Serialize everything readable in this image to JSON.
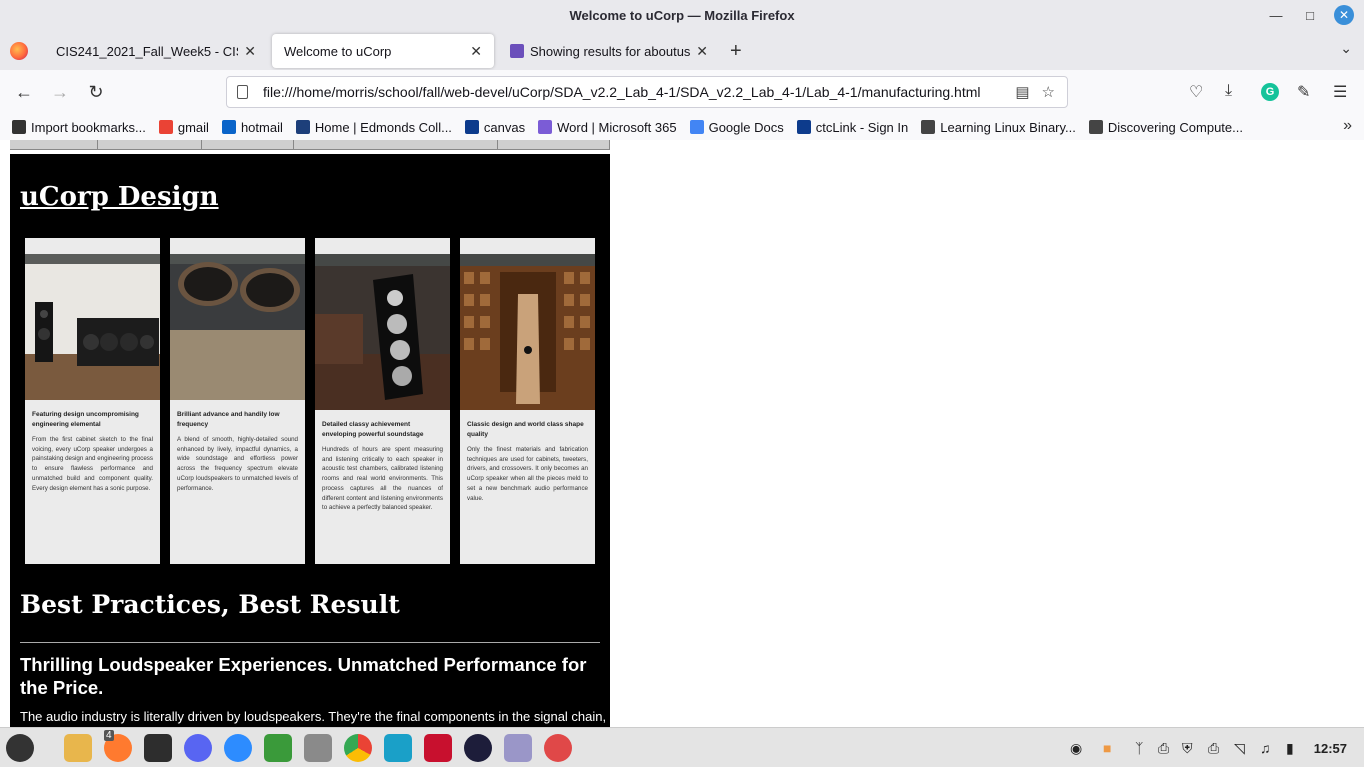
{
  "window": {
    "title": "Welcome to uCorp — Mozilla Firefox"
  },
  "tabs": [
    {
      "label": "CIS241_2021_Fall_Week5 - CIS2",
      "active": false
    },
    {
      "label": "Welcome to uCorp",
      "active": true
    },
    {
      "label": "Showing results for aboutus",
      "active": false
    }
  ],
  "nav": {
    "url": "file:///home/morris/school/fall/web-devel/uCorp/SDA_v2.2_Lab_4-1/SDA_v2.2_Lab_4-1/Lab_4-1/manufacturing.html"
  },
  "bookmarks": [
    {
      "label": "Import bookmarks...",
      "icon": "import-icon",
      "color": "#333333"
    },
    {
      "label": "gmail",
      "icon": "gmail-icon",
      "color": "#ea4335"
    },
    {
      "label": "hotmail",
      "icon": "outlook-icon",
      "color": "#0a64c9"
    },
    {
      "label": "Home | Edmonds Coll...",
      "icon": "edmonds-icon",
      "color": "#1d3f7a"
    },
    {
      "label": "canvas",
      "icon": "canvas-icon",
      "color": "#0d3b8c"
    },
    {
      "label": "Word | Microsoft 365",
      "icon": "m365-icon",
      "color": "#7b5cd6"
    },
    {
      "label": "Google Docs",
      "icon": "docs-icon",
      "color": "#4285f4"
    },
    {
      "label": "ctcLink - Sign In",
      "icon": "ctclink-icon",
      "color": "#0d3b8c"
    },
    {
      "label": "Learning Linux Binary...",
      "icon": "globe-icon",
      "color": "#444444"
    },
    {
      "label": "Discovering Compute...",
      "icon": "page-icon",
      "color": "#444444"
    }
  ],
  "page": {
    "heading": "uCorp Design",
    "cards": [
      {
        "title": "Featuring design uncompromising engineering elemental",
        "body": "From the first cabinet sketch to the final voicing, every uCorp speaker undergoes a painstaking design and engineering process to ensure flawless performance and unmatched build and component quality. Every design element has a sonic purpose."
      },
      {
        "title": "Brilliant advance and handily low frequency",
        "body": "A blend of smooth, highly-detailed sound enhanced by lively, impactful dynamics, a wide soundstage and effortless power across the frequency spectrum elevate uCorp loudspeakers to unmatched levels of performance."
      },
      {
        "title": "Detailed classy achievement enveloping powerful soundstage",
        "body": "Hundreds of hours are spent measuring and listening critically to each speaker in acoustic test chambers, calibrated listening rooms and real world environments. This process captures all the nuances of different content and listening environments to achieve a perfectly balanced speaker."
      },
      {
        "title": "Classic design and world class shape quality",
        "body": "Only the finest materials and fabrication techniques are used for cabinets, tweeters, drivers, and crossovers. It only becomes an uCorp speaker when all the pieces meld to set a new benchmark audio performance value."
      }
    ],
    "section_title": "Best Practices, Best Result",
    "subheading": "Thrilling Loudspeaker Experiences. Unmatched Performance for the Price.",
    "lead": "The audio industry is literally driven by loudspeakers. They're the final components in the signal chain,"
  },
  "taskbar": {
    "clock": "12:57",
    "badge": "4"
  }
}
